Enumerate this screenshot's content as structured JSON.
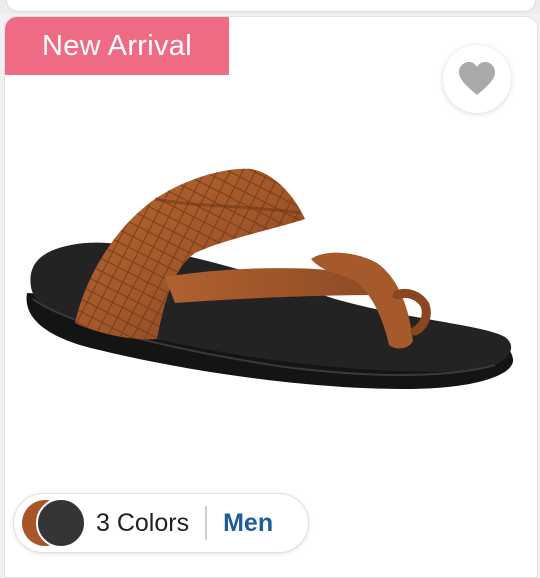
{
  "badge": {
    "label": "New Arrival",
    "color": "#ef6b84"
  },
  "wishlist": {
    "icon": "heart-icon",
    "icon_color": "#a9a9a9"
  },
  "product": {
    "image": "brown-leather-toe-ring-sandal",
    "strap_color": "#a3582a",
    "sole_color": "#1c1c1c"
  },
  "variants": {
    "swatch_colors": [
      "#a8552a",
      "#333537"
    ],
    "colors_label": "3 Colors",
    "gender_label": "Men",
    "gender_color": "#1f5c9c"
  }
}
